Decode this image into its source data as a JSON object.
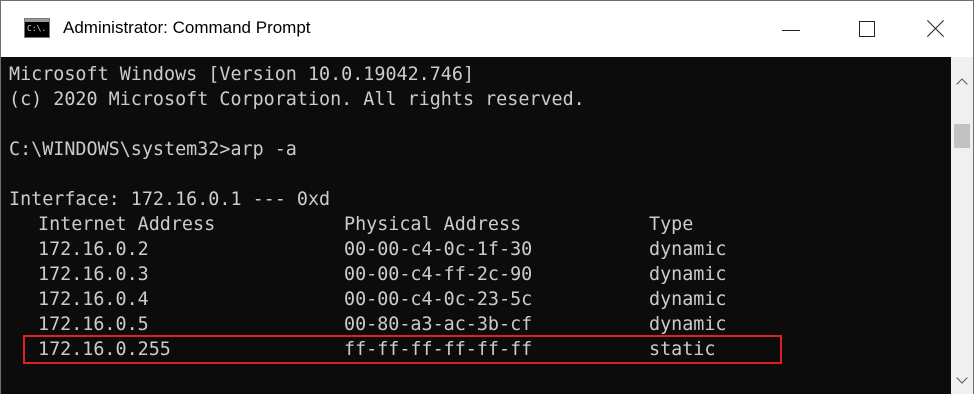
{
  "window": {
    "title": "Administrator: Command Prompt",
    "icon_text": "C:\\.",
    "buttons": [
      "minimize",
      "maximize",
      "close"
    ]
  },
  "console": {
    "lines": [
      "Microsoft Windows [Version 10.0.19042.746]",
      "(c) 2020 Microsoft Corporation. All rights reserved.",
      "",
      "C:\\WINDOWS\\system32>arp -a",
      "",
      "Interface: 172.16.0.1 --- 0xd"
    ],
    "table": {
      "headers": [
        "Internet Address",
        "Physical Address",
        "Type"
      ],
      "rows": [
        [
          "172.16.0.2",
          "00-00-c4-0c-1f-30",
          "dynamic"
        ],
        [
          "172.16.0.3",
          "00-00-c4-ff-2c-90",
          "dynamic"
        ],
        [
          "172.16.0.4",
          "00-00-c4-0c-23-5c",
          "dynamic"
        ],
        [
          "172.16.0.5",
          "00-80-a3-ac-3b-cf",
          "dynamic"
        ],
        [
          "172.16.0.255",
          "ff-ff-ff-ff-ff-ff",
          "static"
        ]
      ],
      "highlighted_row": 3
    }
  },
  "colors": {
    "console_bg": "#0c0c0c",
    "console_text": "#cccccc",
    "highlight": "#e02020",
    "titlebar_bg": "#ffffff"
  },
  "icons": {
    "app": "cmd-icon",
    "minimize": "minimize-icon",
    "maximize": "maximize-icon",
    "close": "close-icon",
    "scroll_up": "chevron-up-icon",
    "scroll_down": "chevron-down-icon"
  }
}
